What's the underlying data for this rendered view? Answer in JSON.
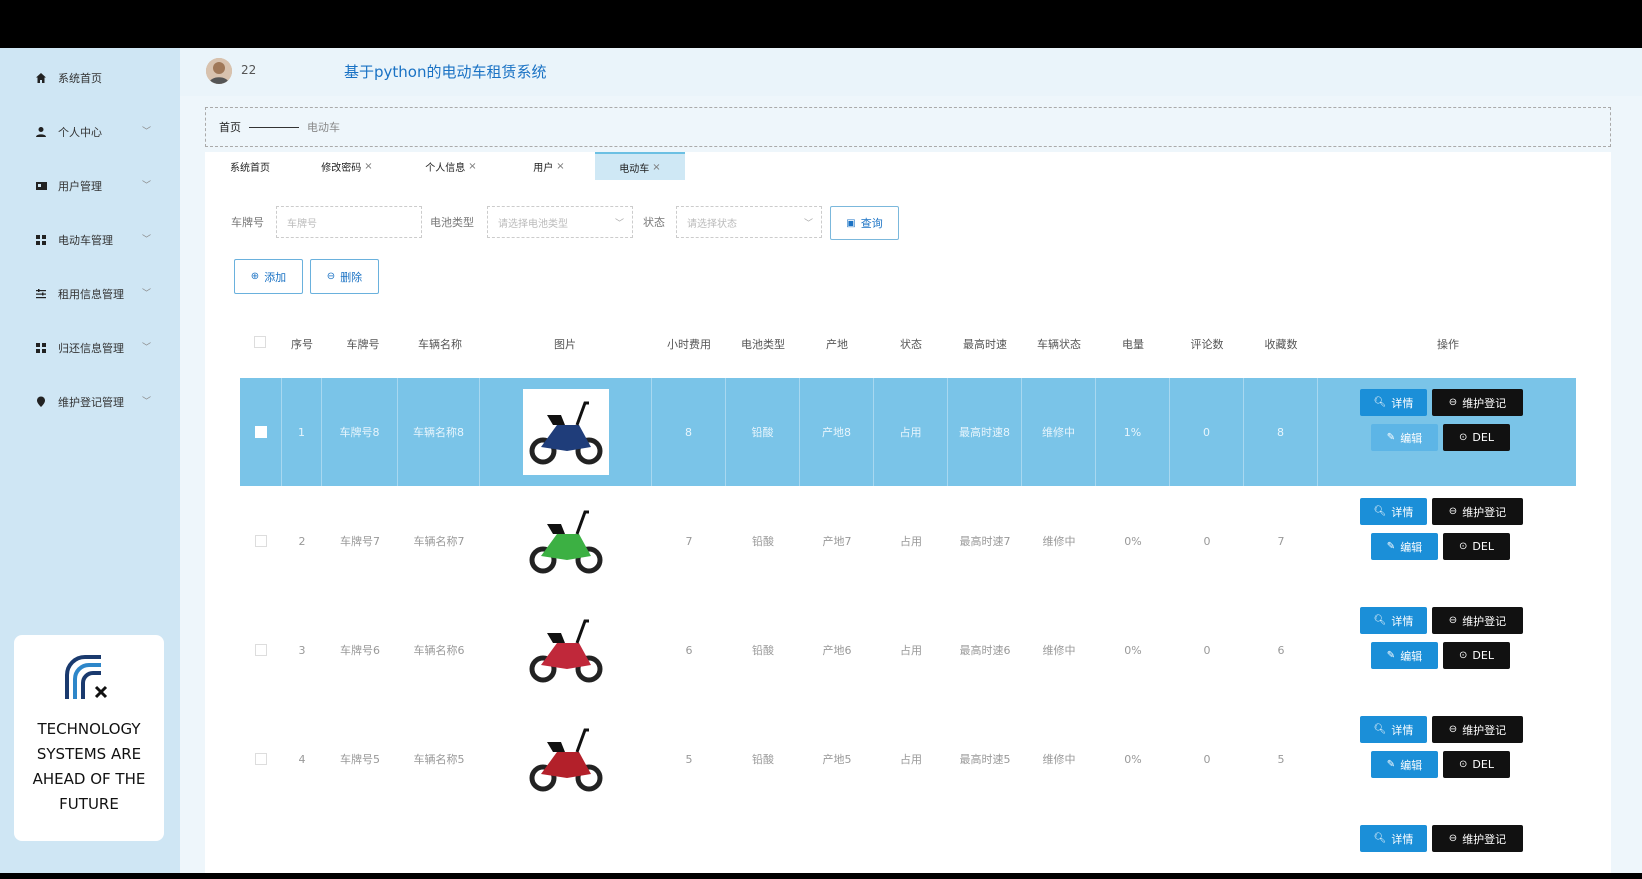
{
  "header": {
    "user_number": "22",
    "system_title": "基于python的电动车租赁系统"
  },
  "sidebar": {
    "items": [
      {
        "label": "系统首页",
        "icon": "home-icon",
        "has_children": false
      },
      {
        "label": "个人中心",
        "icon": "user-icon",
        "has_children": true
      },
      {
        "label": "用户管理",
        "icon": "users-icon",
        "has_children": true
      },
      {
        "label": "电动车管理",
        "icon": "grid-icon",
        "has_children": true
      },
      {
        "label": "租用信息管理",
        "icon": "sliders-icon",
        "has_children": true
      },
      {
        "label": "归还信息管理",
        "icon": "grid-icon",
        "has_children": true
      },
      {
        "label": "维护登记管理",
        "icon": "location-icon",
        "has_children": true
      }
    ],
    "promo_text": "TECHNOLOGY\nSYSTEMS  ARE\nAHEAD OF THE\nFUTURE"
  },
  "breadcrumb": {
    "home": "首页",
    "current": "电动车"
  },
  "tabs": [
    {
      "label": "系统首页",
      "closable": false,
      "active": false
    },
    {
      "label": "修改密码",
      "closable": true,
      "active": false
    },
    {
      "label": "个人信息",
      "closable": true,
      "active": false
    },
    {
      "label": "用户",
      "closable": true,
      "active": false
    },
    {
      "label": "电动车",
      "closable": true,
      "active": true
    }
  ],
  "search": {
    "plate_label": "车牌号",
    "plate_placeholder": "车牌号",
    "battery_label": "电池类型",
    "battery_placeholder": "请选择电池类型",
    "status_label": "状态",
    "status_placeholder": "请选择状态",
    "query_label": "查询"
  },
  "actions": {
    "add_label": "添加",
    "delete_label": "删除"
  },
  "table": {
    "headers": [
      "序号",
      "车牌号",
      "车辆名称",
      "图片",
      "小时费用",
      "电池类型",
      "产地",
      "状态",
      "最高时速",
      "车辆状态",
      "电量",
      "评论数",
      "收藏数",
      "操作"
    ],
    "rows": [
      {
        "no": "1",
        "plate": "车牌号8",
        "name": "车辆名称8",
        "fee": "8",
        "battery": "铅酸",
        "origin": "产地8",
        "status": "占用",
        "speed": "最高时速8",
        "vstatus": "维修中",
        "power": "1%",
        "comments": "0",
        "favs": "8",
        "bike_color": "#1f3d7a",
        "selected": true
      },
      {
        "no": "2",
        "plate": "车牌号7",
        "name": "车辆名称7",
        "fee": "7",
        "battery": "铅酸",
        "origin": "产地7",
        "status": "占用",
        "speed": "最高时速7",
        "vstatus": "维修中",
        "power": "0%",
        "comments": "0",
        "favs": "7",
        "bike_color": "#3cb043",
        "selected": false
      },
      {
        "no": "3",
        "plate": "车牌号6",
        "name": "车辆名称6",
        "fee": "6",
        "battery": "铅酸",
        "origin": "产地6",
        "status": "占用",
        "speed": "最高时速6",
        "vstatus": "维修中",
        "power": "0%",
        "comments": "0",
        "favs": "6",
        "bike_color": "#c0283a",
        "selected": false
      },
      {
        "no": "4",
        "plate": "车牌号5",
        "name": "车辆名称5",
        "fee": "5",
        "battery": "铅酸",
        "origin": "产地5",
        "status": "占用",
        "speed": "最高时速5",
        "vstatus": "维修中",
        "power": "0%",
        "comments": "0",
        "favs": "5",
        "bike_color": "#b3202a",
        "selected": false
      }
    ],
    "buttons": {
      "detail": "详情",
      "maintain": "维护登记",
      "edit": "编辑",
      "del": "DEL"
    }
  }
}
